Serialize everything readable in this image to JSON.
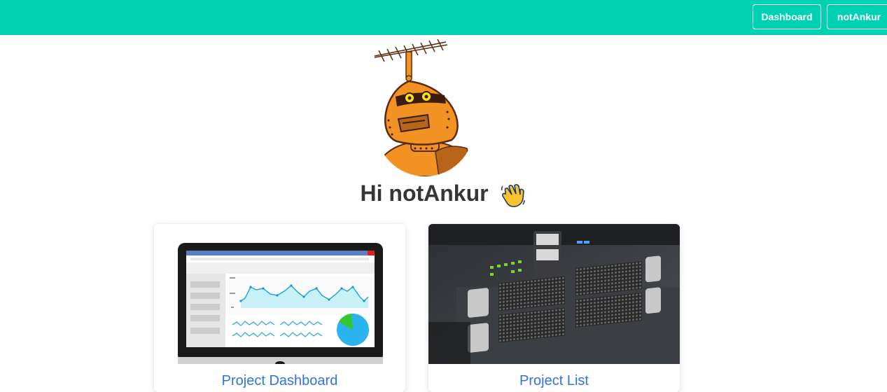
{
  "navbar": {
    "color": "#00d1b2",
    "dashboard_label": "Dashboard",
    "user_label": "notAnkur"
  },
  "greeting": {
    "text": "Hi notAnkur",
    "emoji_icon": "waving-hand-icon"
  },
  "cards": [
    {
      "title": "Project Dashboard",
      "image_icon": "dashboard-monitor-image"
    },
    {
      "title": "Project List",
      "image_icon": "server-rack-image"
    }
  ]
}
